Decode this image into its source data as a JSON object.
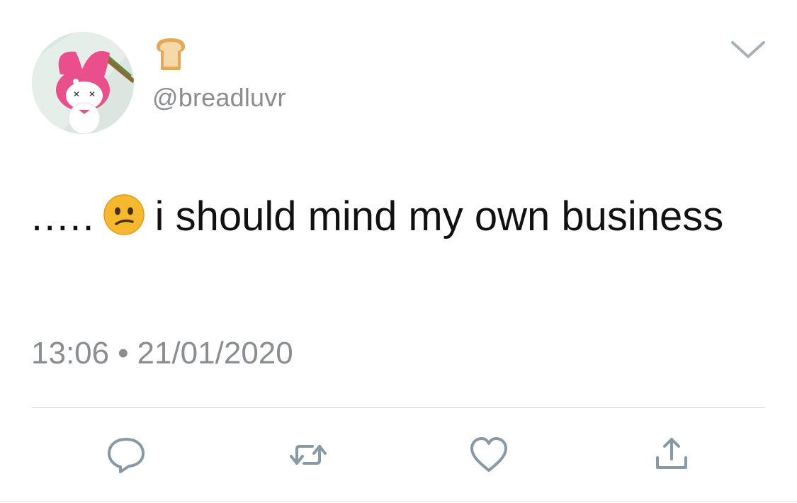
{
  "user": {
    "display_name": "🍞",
    "handle": "@breadluvr",
    "avatar": "my-melody-avatar"
  },
  "tweet": {
    "leading_dots": ".....",
    "emoji": "😕",
    "text_after_emoji": "i should mind my own business"
  },
  "meta": {
    "time": "13:06",
    "separator": "•",
    "date": "21/01/2020"
  },
  "actions": [
    {
      "name": "reply",
      "icon": "reply-icon"
    },
    {
      "name": "retweet",
      "icon": "retweet-icon"
    },
    {
      "name": "like",
      "icon": "heart-icon"
    },
    {
      "name": "share",
      "icon": "share-icon"
    }
  ],
  "colors": {
    "text": "#111111",
    "muted": "#8a8d91",
    "icon": "#8899a6",
    "divider": "#d4d7da"
  }
}
